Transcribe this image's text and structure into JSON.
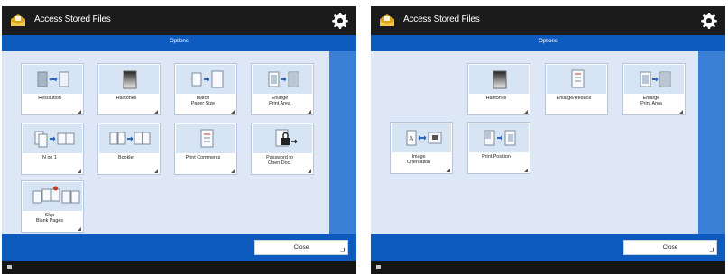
{
  "screens": [
    {
      "title": "Access Stored Files",
      "subtitle": "Options",
      "close_label": "Close",
      "tiles": [
        {
          "label": "Resolution",
          "icon": "resolution-icon"
        },
        {
          "label": "Halftones",
          "icon": "halftones-icon"
        },
        {
          "label": "Match\nPaper Size",
          "icon": "match-paper-size-icon"
        },
        {
          "label": "Enlarge\nPrint Area",
          "icon": "enlarge-print-area-icon"
        },
        {
          "label": "N on 1",
          "icon": "n-on-1-icon"
        },
        {
          "label": "Booklet",
          "icon": "booklet-icon"
        },
        {
          "label": "Print Comments",
          "icon": "print-comments-icon"
        },
        {
          "label": "Password to\nOpen Doc.",
          "icon": "password-icon"
        },
        {
          "label": "Skip\nBlank Pages",
          "icon": "skip-blank-pages-icon"
        }
      ]
    },
    {
      "title": "Access Stored Files",
      "subtitle": "Options",
      "close_label": "Close",
      "tiles": [
        {
          "label": "Halftones",
          "icon": "halftones-icon"
        },
        {
          "label": "Enlarge/Reduce",
          "icon": "enlarge-reduce-icon"
        },
        {
          "label": "Enlarge\nPrint Area",
          "icon": "enlarge-print-area-icon"
        },
        {
          "label": "Image\nOrientation",
          "icon": "image-orientation-icon"
        },
        {
          "label": "Print Position",
          "icon": "print-position-icon"
        }
      ]
    }
  ],
  "colors": {
    "titlebar": "#1b1b1b",
    "accent_blue": "#0e5bbf",
    "content_bg": "#dde7f5",
    "scroll_column": "#3a7fd6",
    "tile_art_bg": "#d7e4f4"
  }
}
